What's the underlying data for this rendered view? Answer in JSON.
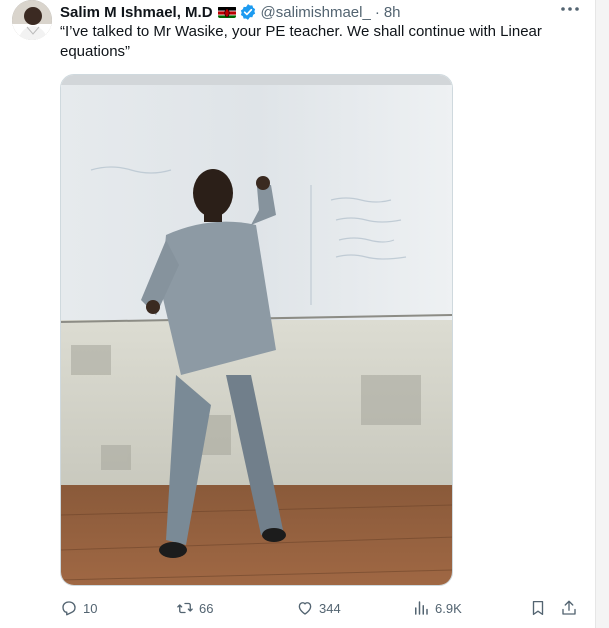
{
  "tweet": {
    "author_name": "Salim M Ishmael, M.D",
    "handle": "@salimishmael_",
    "separator": "·",
    "time": "8h",
    "text": "“I’ve talked to Mr Wasike, your PE teacher. We shall continue with Linear equations”"
  },
  "icons": {
    "avatar": "profile-photo",
    "flag": "kenya-flag-icon",
    "verified": "verified-badge-icon",
    "more": "more-options-icon"
  },
  "actions": {
    "replies": "10",
    "reposts": "66",
    "likes": "344",
    "views": "6.9K"
  },
  "colors": {
    "text": "#0f1419",
    "secondary": "#536471",
    "verified_blue": "#1d9bf0"
  }
}
